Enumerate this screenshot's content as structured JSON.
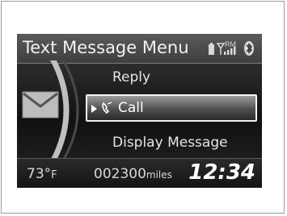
{
  "header": {
    "title": "Text Message Menu",
    "status_icons": [
      "battery-icon",
      "signal-strength-icon",
      "bluetooth-icon"
    ],
    "roaming_label": "RM"
  },
  "menu": {
    "items": [
      {
        "label": "Reply",
        "selected": false
      },
      {
        "label": "Call",
        "selected": true,
        "icon": "phone-icon"
      },
      {
        "label": "Display Message",
        "selected": false
      }
    ]
  },
  "side_icon": "envelope-icon",
  "footer": {
    "temperature": "73°",
    "temperature_unit": "F",
    "odometer": "002300",
    "odometer_unit": "miles",
    "clock": "12:34"
  },
  "colors": {
    "screen_background": "#1b1b1b",
    "header_background": "#4a4a4a",
    "highlight_border": "#f4f4f4",
    "text": "#e6e6e6"
  }
}
